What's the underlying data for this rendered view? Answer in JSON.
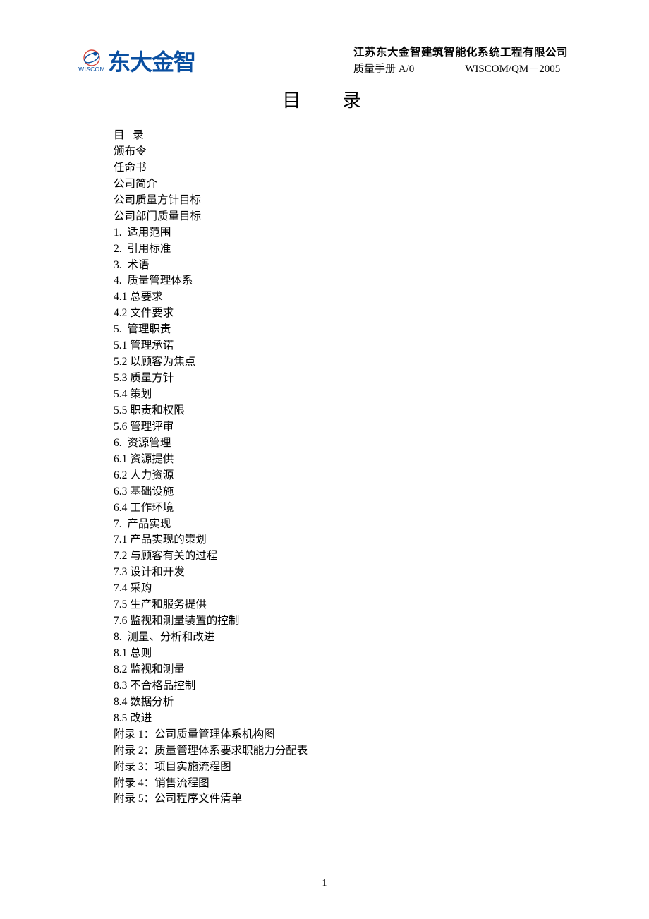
{
  "header": {
    "brand": "东大金智",
    "wiscom": "WISCOM",
    "company": "江苏东大金智建筑智能化系统工程有限公司",
    "doc": "质量手册   A/0",
    "code": "WISCOM/QM－2005"
  },
  "title": "目    录",
  "toc": [
    "目   录",
    "颁布令",
    "任命书",
    "公司简介",
    "公司质量方针目标",
    "公司部门质量目标",
    "1.  适用范围",
    "2.  引用标准",
    "3.  术语",
    "4.  质量管理体系",
    "4.1 总要求",
    "4.2 文件要求",
    "5.  管理职责",
    "5.1 管理承诺",
    "5.2 以顾客为焦点",
    "5.3 质量方针",
    "5.4 策划",
    "5.5 职责和权限",
    "5.6 管理评审",
    "6.  资源管理",
    "6.1 资源提供",
    "6.2 人力资源",
    "6.3 基础设施",
    "6.4 工作环境",
    "7.  产品实现",
    "7.1 产品实现的策划",
    "7.2 与顾客有关的过程",
    "7.3 设计和开发",
    "7.4 采购",
    "7.5 生产和服务提供",
    "7.6 监视和测量装置的控制",
    "8.  测量、分析和改进",
    "8.1 总则",
    "8.2 监视和测量",
    "8.3 不合格品控制",
    "8.4 数据分析",
    "8.5 改进",
    "附录 1：公司质量管理体系机构图",
    "附录 2：质量管理体系要求职能力分配表",
    "附录 3：项目实施流程图",
    "附录 4：销售流程图",
    "附录 5：公司程序文件清单"
  ],
  "page_number": "1"
}
